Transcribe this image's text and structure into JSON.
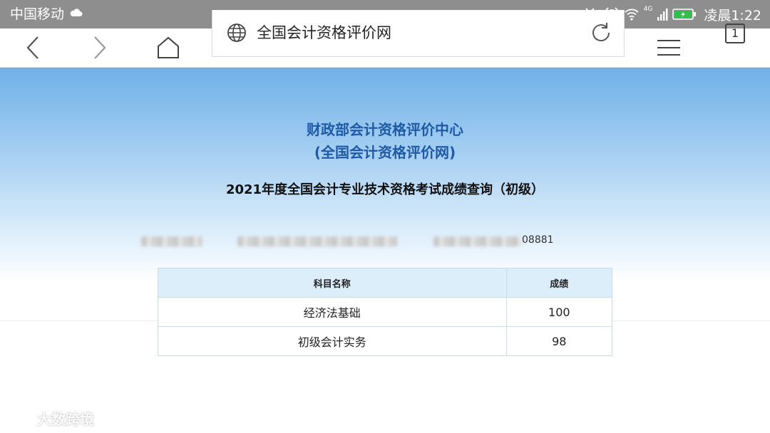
{
  "status_bar": {
    "carrier": "中国移动",
    "network": "4G",
    "time": "凌晨1:22"
  },
  "toolbar": {
    "address_text": "全国会计资格评价网",
    "tab_count": "1"
  },
  "page": {
    "org_line1": "财政部会计资格评价中心",
    "org_line2": "(全国会计资格评价网)",
    "query_title": "2021年度全国会计专业技术资格考试成绩查询（初级）",
    "id_suffix": "08881",
    "table": {
      "headers": [
        "科目名称",
        "成绩"
      ],
      "rows": [
        {
          "subject": "经济法基础",
          "score": "100"
        },
        {
          "subject": "初级会计实务",
          "score": "98"
        }
      ]
    }
  },
  "watermark": {
    "text": "大数跨境"
  },
  "colors": {
    "status_bar": "#8e8e8e",
    "hero_top": "#6fb0e8",
    "org_blue": "#1f5aa6",
    "table_header": "#dceefa",
    "table_border": "#c9dceb"
  }
}
